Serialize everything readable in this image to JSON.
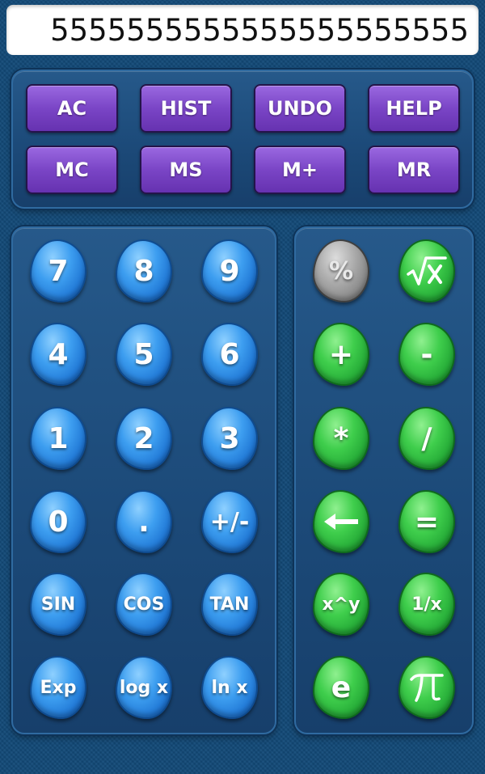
{
  "display": {
    "value": "5555555555555555555555"
  },
  "memory_row1": [
    {
      "name": "ac-button",
      "label": "AC"
    },
    {
      "name": "hist-button",
      "label": "HIST"
    },
    {
      "name": "undo-button",
      "label": "UNDO"
    },
    {
      "name": "help-button",
      "label": "HELP"
    }
  ],
  "memory_row2": [
    {
      "name": "mc-button",
      "label": "MC"
    },
    {
      "name": "ms-button",
      "label": "MS"
    },
    {
      "name": "m-plus-button",
      "label": "M+"
    },
    {
      "name": "mr-button",
      "label": "MR"
    }
  ],
  "number_keys": {
    "k7": "7",
    "k8": "8",
    "k9": "9",
    "k4": "4",
    "k5": "5",
    "k6": "6",
    "k1": "1",
    "k2": "2",
    "k3": "3",
    "k0": "0",
    "dot": ".",
    "sign": "+/-",
    "sin": "SIN",
    "cos": "COS",
    "tan": "TAN",
    "exp": "Exp",
    "log": "log x",
    "ln": "ln x"
  },
  "op_keys": {
    "percent": "%",
    "plus": "+",
    "minus": "-",
    "multiply": "*",
    "divide": "/",
    "equals": "=",
    "power": "x^y",
    "reciprocal": "1/x",
    "e": "e"
  },
  "icons": {
    "sqrt": "square-root-icon",
    "backspace": "backspace-arrow-icon",
    "pi": "pi-icon"
  },
  "colors": {
    "background": "#134a78",
    "memory_button": "#7a45c6",
    "number_key": "#3d9ef0",
    "operator_key": "#3fce4c",
    "percent_key": "#a7a7a7"
  }
}
